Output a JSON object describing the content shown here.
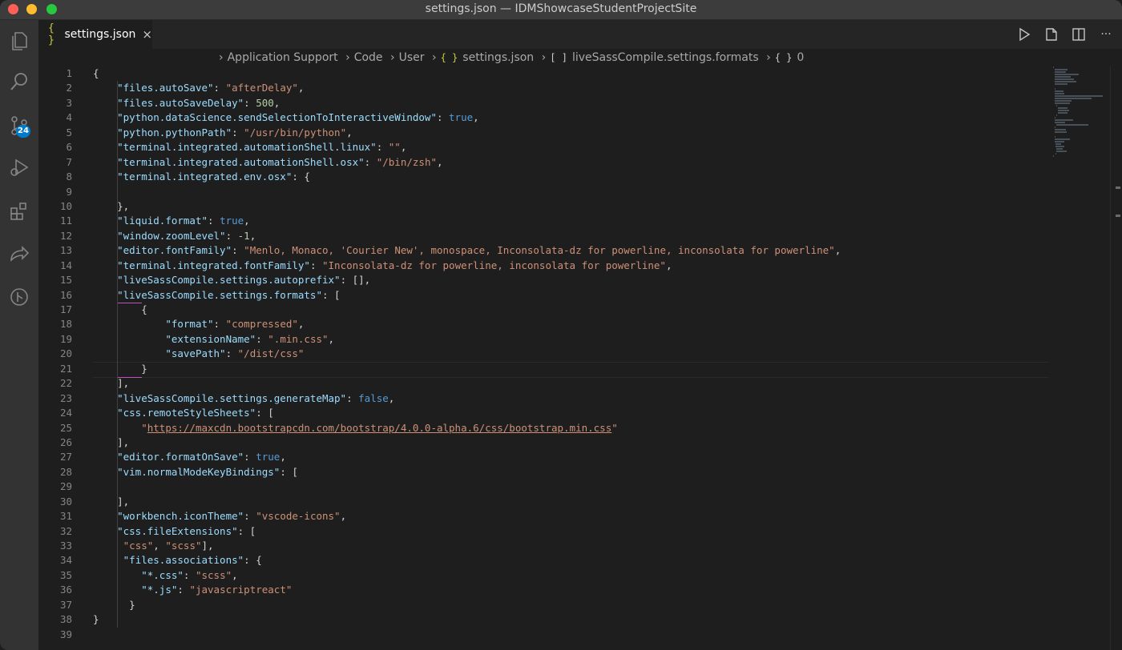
{
  "window": {
    "title": "settings.json — IDMShowcaseStudentProjectSite"
  },
  "activity_bar": {
    "items": [
      {
        "name": "explorer-icon"
      },
      {
        "name": "search-icon"
      },
      {
        "name": "source-control-icon",
        "badge": "24"
      },
      {
        "name": "run-debug-icon"
      },
      {
        "name": "extensions-icon"
      },
      {
        "name": "live-share-icon"
      },
      {
        "name": "git-graph-icon"
      }
    ],
    "accent": "#007acc"
  },
  "tabs": [
    {
      "icon": "{ }",
      "label": "settings.json",
      "close": "×"
    }
  ],
  "editor_actions": [
    "run-icon",
    "open-preview-icon",
    "split-editor-icon",
    "more-actions-icon"
  ],
  "editor_actions_more": "···",
  "breadcrumbs": {
    "items": [
      "Application Support",
      "Code",
      "User",
      "settings.json",
      "liveSassCompile.settings.formats",
      "0"
    ],
    "json_icon": "{ }",
    "array_icon": "[ ]",
    "object_icon": "{ }"
  },
  "line_numbers": [
    "1",
    "2",
    "3",
    "4",
    "5",
    "6",
    "7",
    "8",
    "9",
    "10",
    "11",
    "12",
    "13",
    "14",
    "15",
    "16",
    "17",
    "18",
    "19",
    "20",
    "21",
    "22",
    "23",
    "24",
    "25",
    "26",
    "27",
    "28",
    "29",
    "30",
    "31",
    "32",
    "33",
    "34",
    "35",
    "36",
    "37",
    "38",
    "39"
  ],
  "code": {
    "l1": "{",
    "l2": [
      "\"files.autoSave\"",
      ": ",
      "\"afterDelay\"",
      ","
    ],
    "l3": [
      "\"files.autoSaveDelay\"",
      ": ",
      "500",
      ","
    ],
    "l4": [
      "\"python.dataScience.sendSelectionToInteractiveWindow\"",
      ": ",
      "true",
      ","
    ],
    "l5": [
      "\"python.pythonPath\"",
      ": ",
      "\"/usr/bin/python\"",
      ","
    ],
    "l6": [
      "\"terminal.integrated.automationShell.linux\"",
      ": ",
      "\"\"",
      ","
    ],
    "l7": [
      "\"terminal.integrated.automationShell.osx\"",
      ": ",
      "\"/bin/zsh\"",
      ","
    ],
    "l8": [
      "\"terminal.integrated.env.osx\"",
      ": {"
    ],
    "l10": "},",
    "l11": [
      "\"liquid.format\"",
      ": ",
      "true",
      ","
    ],
    "l12": [
      "\"window.zoomLevel\"",
      ": ",
      "-1",
      ","
    ],
    "l13": [
      "\"editor.fontFamily\"",
      ": ",
      "\"Menlo, Monaco, 'Courier New', monospace, Inconsolata-dz for powerline, inconsolata for powerline\"",
      ","
    ],
    "l14": [
      "\"terminal.integrated.fontFamily\"",
      ": ",
      "\"Inconsolata-dz for powerline, inconsolata for powerline\"",
      ","
    ],
    "l15": [
      "\"liveSassCompile.settings.autoprefix\"",
      ": [],"
    ],
    "l16": [
      "\"liveSassCompile.settings.formats\"",
      ": ["
    ],
    "l17": "{",
    "l18": [
      "\"format\"",
      ": ",
      "\"compressed\"",
      ","
    ],
    "l19": [
      "\"extensionName\"",
      ": ",
      "\".min.css\"",
      ","
    ],
    "l20": [
      "\"savePath\"",
      ": ",
      "\"/dist/css\""
    ],
    "l21": "}",
    "l22": "],",
    "l23": [
      "\"liveSassCompile.settings.generateMap\"",
      ": ",
      "false",
      ","
    ],
    "l24": [
      "\"css.remoteStyleSheets\"",
      ": ["
    ],
    "l25": [
      "\"",
      "https://maxcdn.bootstrapcdn.com/bootstrap/4.0.0-alpha.6/css/bootstrap.min.css",
      "\""
    ],
    "l26": "],",
    "l27": [
      "\"editor.formatOnSave\"",
      ": ",
      "true",
      ","
    ],
    "l28": [
      "\"vim.normalModeKeyBindings\"",
      ": ["
    ],
    "l30": "],",
    "l31": [
      "\"workbench.iconTheme\"",
      ": ",
      "\"vscode-icons\"",
      ","
    ],
    "l32": [
      "\"css.fileExtensions\"",
      ": ["
    ],
    "l33": [
      "\"css\"",
      ", ",
      "\"scss\"",
      "],"
    ],
    "l34": [
      "\"files.associations\"",
      ": {"
    ],
    "l35": [
      "\"*.css\"",
      ": ",
      "\"scss\"",
      ","
    ],
    "l36": [
      "\"*.js\"",
      ": ",
      "\"javascriptreact\""
    ],
    "l37": "}",
    "l38": "}"
  },
  "colors": {
    "background": "#1e1e1e",
    "key": "#9cdcfe",
    "string": "#ce9178",
    "number": "#b5cea8",
    "boolean": "#569cd6",
    "bracket_guide": "#c04fc0"
  }
}
